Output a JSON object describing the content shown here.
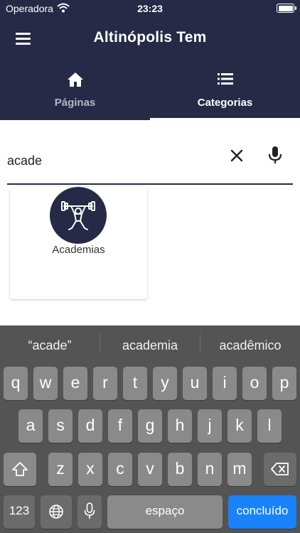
{
  "status_bar": {
    "carrier": "Operadora",
    "time": "23:23"
  },
  "app_bar": {
    "title": "Altinópolis Tem"
  },
  "tabs": [
    {
      "label": "Páginas",
      "icon": "home-icon",
      "selected": false
    },
    {
      "label": "Categorias",
      "icon": "list-icon",
      "selected": true
    }
  ],
  "search": {
    "value": "acade"
  },
  "results": [
    {
      "label": "Academias",
      "icon": "weightlifting-icon"
    }
  ],
  "keyboard": {
    "suggestions": [
      "“acade”",
      "academia",
      "acadêmico"
    ],
    "row1": [
      "q",
      "w",
      "e",
      "r",
      "t",
      "y",
      "u",
      "i",
      "o",
      "p"
    ],
    "row2": [
      "a",
      "s",
      "d",
      "f",
      "g",
      "h",
      "j",
      "k",
      "l"
    ],
    "row3": [
      "z",
      "x",
      "c",
      "v",
      "b",
      "n",
      "m"
    ],
    "numbers_label": "123",
    "space_label": "espaço",
    "return_label": "concluído"
  },
  "colors": {
    "primary": "#262a47",
    "keyboard_bg": "#545454",
    "key": "#8a8a8a",
    "done": "#1a82fb"
  }
}
